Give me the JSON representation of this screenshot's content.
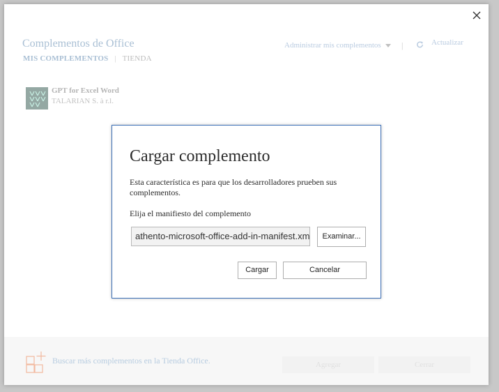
{
  "outer": {
    "title": "Complementos de Office",
    "tabs": [
      {
        "label": "MIS COMPLEMENTOS",
        "active": true
      },
      {
        "label": "TIENDA",
        "active": false
      }
    ],
    "tab_separator": "|",
    "manage_label": "Administrar mis complementos",
    "separator": "|",
    "refresh_label": "Actualizar",
    "addons": [
      {
        "name": "GPT for Excel Word",
        "vendor": "TALARIAN S. à r.l."
      }
    ],
    "footer": {
      "store_link": "Buscar más complementos en la Tienda Office.",
      "add_button": "Agregar",
      "close_button": "Cerrar"
    }
  },
  "modal": {
    "title": "Cargar complemento",
    "description": "Esta característica es para que los desarrolladores prueben sus complementos.",
    "manifest_label": "Elija el manifiesto del complemento",
    "manifest_value": "athento-microsoft-office-add-in-manifest.xml",
    "browse_button": "Examinar...",
    "load_button": "Cargar",
    "cancel_button": "Cancelar"
  },
  "colors": {
    "modal_border": "#3c6fb6",
    "overlay": "#c8c8c8",
    "faded_link": "#a9bfd4"
  },
  "icons": [
    "close-icon",
    "chevron-down-icon",
    "refresh-icon",
    "addon-logo-icon",
    "add-store-icon"
  ]
}
